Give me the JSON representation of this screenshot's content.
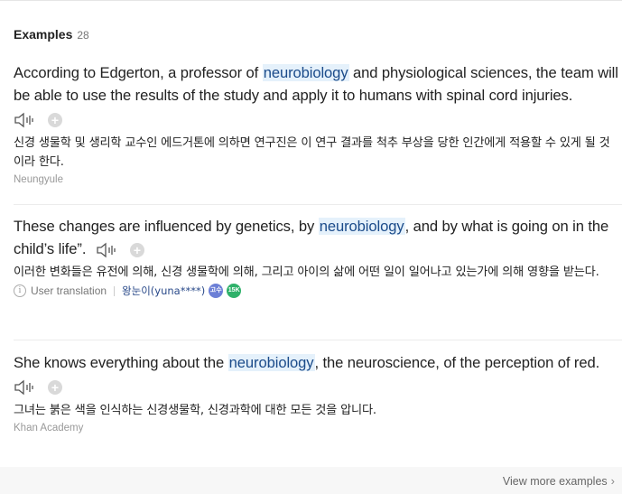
{
  "section": {
    "title": "Examples",
    "count": "28"
  },
  "examples": [
    {
      "en_before": "According to Edgerton, a professor of ",
      "en_highlight": "neurobiology",
      "en_after": " and physiological sciences, the team will be able to use the results of the study and apply it to humans with spinal cord injuries.",
      "ko": "신경 생물학 및 생리학 교수인 에드거톤에 의하면 연구진은 이 연구 결과를 척추 부상을 당한 인간에게 적용할 수 있게 될 것이라 한다.",
      "source": "Neungyule"
    },
    {
      "en_before": "These changes are influenced by genetics, by ",
      "en_highlight": "neurobiology",
      "en_after": ", and by what is going on in the child’s life”.",
      "ko": "이러한 변화들은 유전에 의해, 신경 생물학에 의해, 그리고 아이의 삶에 어떤 일이 일어나고 있는가에 의해 영향을 받는다.",
      "meta_label": "User translation",
      "user": "왕눈이(yuna****)",
      "badge1": "고수",
      "badge2": "15K"
    },
    {
      "en_before": "She knows everything about the ",
      "en_highlight": "neurobiology",
      "en_after": ", the neuroscience, of the perception of red.",
      "ko": "그녀는 붉은 색을 인식하는 신경생물학, 신경과학에 대한 모든 것을 압니다.",
      "source": "Khan Academy"
    }
  ],
  "icons": {
    "speaker": "speaker-icon",
    "add": "plus-icon",
    "info": "info-icon",
    "chevron": "chevron-right-icon"
  },
  "footer": {
    "view_more": "View more examples",
    "chevron": "›"
  },
  "plus_glyph": "+",
  "info_glyph": "i"
}
